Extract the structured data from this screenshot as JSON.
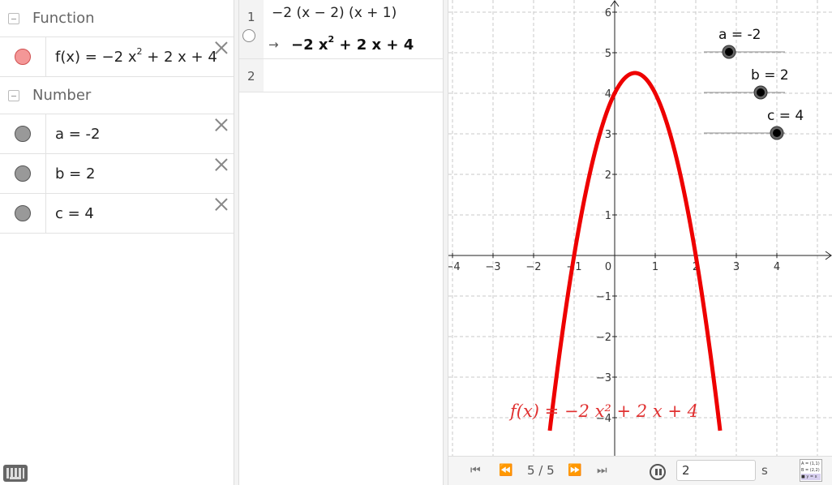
{
  "algebra": {
    "function_group": {
      "title": "Function",
      "items": [
        {
          "name": "f(x)",
          "expr_prefix": "f(x)  =  −2 x",
          "exp": "2",
          "expr_suffix": " + 2 x + 4",
          "color": "#f07070"
        }
      ]
    },
    "number_group": {
      "title": "Number",
      "items": [
        {
          "expr": "a  =  -2",
          "color": "#999999"
        },
        {
          "expr": "b  =  2",
          "color": "#999999"
        },
        {
          "expr": "c  =  4",
          "color": "#999999"
        }
      ]
    }
  },
  "cas": {
    "rows": [
      {
        "num": "1",
        "input": "−2 (x − 2) (x + 1)",
        "arrow": "→",
        "output_prefix": "−2 x",
        "output_exp": "2",
        "output_suffix": " + 2 x + 4"
      },
      {
        "num": "2",
        "input": ""
      }
    ]
  },
  "graphics": {
    "x_ticks": [
      "−4",
      "−3",
      "−2",
      "−1",
      "0",
      "1",
      "2",
      "3",
      "4"
    ],
    "y_ticks": [
      "6",
      "5",
      "4",
      "3",
      "2",
      "1",
      "−1",
      "−2",
      "−3",
      "−4"
    ],
    "function_label": "f(x)  =  −2 x² + 2 x + 4",
    "curve_color": "#ee0000",
    "sliders": [
      {
        "label": "a = -2",
        "value": -2
      },
      {
        "label": "b = 2",
        "value": 2
      },
      {
        "label": "c = 4",
        "value": 4
      }
    ]
  },
  "chart_data": {
    "type": "line",
    "title": "",
    "xlabel": "",
    "ylabel": "",
    "xlim": [
      -4.3,
      5.0
    ],
    "ylim": [
      -4.9,
      6.3
    ],
    "grid": true,
    "series": [
      {
        "name": "f(x)",
        "function": "-2x^2 + 2x + 4",
        "x": [
          -1.6,
          -1,
          0,
          0.5,
          1,
          2,
          2.6
        ],
        "y": [
          -4.32,
          0,
          4,
          4.5,
          4,
          0,
          -4.32
        ]
      }
    ]
  },
  "playbar": {
    "page": "5 / 5",
    "speed": "2",
    "unit": "s",
    "first_icon": "skip-first-icon",
    "prev_icon": "rewind-icon",
    "next_icon": "fast-forward-icon",
    "last_icon": "skip-last-icon"
  },
  "algebra_icon_lines": [
    "A = (1,1)",
    "B = (2,2)",
    "■ y = x"
  ]
}
